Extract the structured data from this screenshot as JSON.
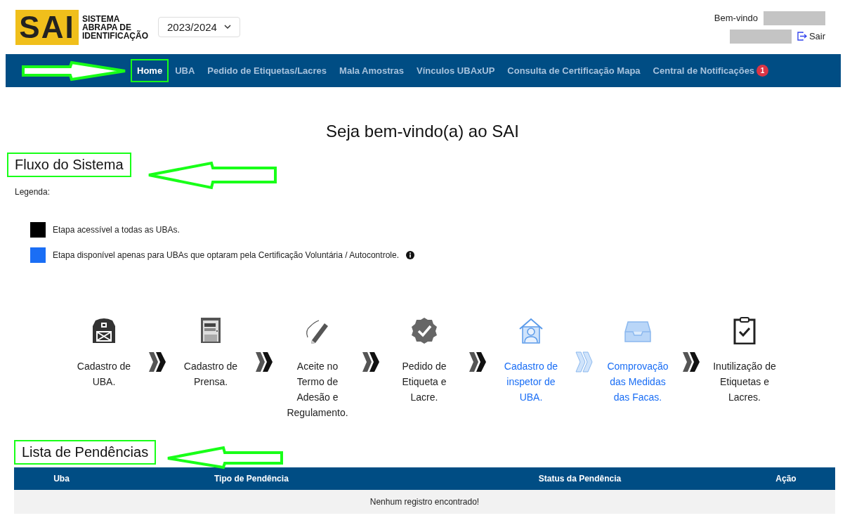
{
  "header": {
    "logo": {
      "mark": "SAI",
      "lines": [
        "SISTEMA",
        "ABRAPA DE",
        "IDENTIFICAÇÃO"
      ]
    },
    "season_select": {
      "value": "2023/2024"
    },
    "user": {
      "greeting": "Bem-vindo",
      "logout": "Sair"
    }
  },
  "nav": [
    {
      "label": "Home",
      "selected": true,
      "highlighted": true
    },
    {
      "label": "UBA",
      "selected": false,
      "highlighted": false
    },
    {
      "label": "Pedido de Etiquetas/Lacres",
      "selected": false,
      "highlighted": false
    },
    {
      "label": "Mala Amostras",
      "selected": false,
      "highlighted": false
    },
    {
      "label": "Vínculos UBAxUP",
      "selected": false,
      "highlighted": false
    },
    {
      "label": "Consulta de Certificação Mapa",
      "selected": false,
      "highlighted": false
    },
    {
      "label": "Central de Notificações",
      "selected": false,
      "highlighted": false,
      "badge": "1"
    }
  ],
  "page_title": "Seja bem-vindo(a) ao SAI",
  "flow": {
    "title": "Fluxo do Sistema",
    "highlighted": true,
    "legend_label": "Legenda:",
    "legend": [
      {
        "text": "Etapa acessível a todas as UBAs.",
        "color": "#000000",
        "has_info": false
      },
      {
        "text": "Etapa disponível apenas para UBAs que optaram pela Certificação Voluntária / Autocontrole.",
        "color": "#1a6ef5",
        "has_info": true
      }
    ],
    "steps": [
      {
        "kind": "general",
        "label": "Cadastro de UBA."
      },
      {
        "kind": "general",
        "label": "Cadastro de Prensa."
      },
      {
        "kind": "general",
        "label": "Aceite no Termo de Adesão e Regulamento."
      },
      {
        "kind": "general",
        "label": "Pedido de Etiqueta e Lacre."
      },
      {
        "kind": "voluntary",
        "label": "Cadastro de inspetor de UBA."
      },
      {
        "kind": "voluntary",
        "label": "Comprovação das Medidas das Facas."
      },
      {
        "kind": "general",
        "label": "Inutilização de Etiquetas e Lacres."
      }
    ]
  },
  "pending": {
    "title": "Lista de Pendências",
    "highlighted": true,
    "columns": [
      "Uba",
      "Tipo de Pendência",
      "Status da Pendência",
      "Ação"
    ],
    "empty_message": "Nenhum registro encontrado!"
  }
}
